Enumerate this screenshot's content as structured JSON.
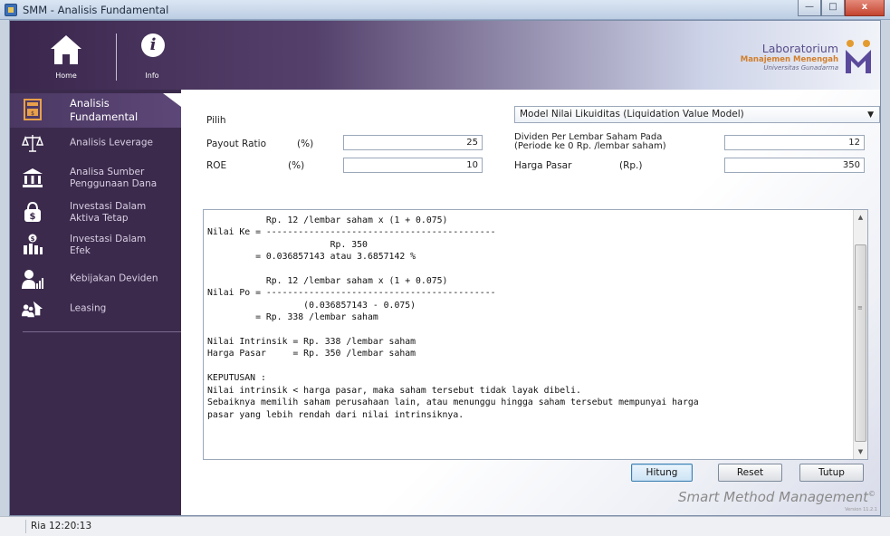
{
  "window": {
    "title": "SMM - Analisis Fundamental",
    "buttons": {
      "minimize": "—",
      "maximize": "□",
      "close": "x"
    }
  },
  "header": {
    "home_label": "Home",
    "info_label": "Info",
    "lab_line1": "Laboratorium",
    "lab_line2": "Manajemen Menengah",
    "lab_line3": "Universitas Gunadarma"
  },
  "sidebar": {
    "items": [
      {
        "label_line1": "Analisis",
        "label_line2": "Fundamental",
        "active": true,
        "icon": "calculator-icon"
      },
      {
        "label_line1": "Analisis Leverage",
        "label_line2": "",
        "icon": "balance-scale-icon"
      },
      {
        "label_line1": "Analisa Sumber",
        "label_line2": "Penggunaan Dana",
        "icon": "bank-icon"
      },
      {
        "label_line1": "Investasi Dalam",
        "label_line2": "Aktiva Tetap",
        "icon": "money-bag-icon"
      },
      {
        "label_line1": "Investasi Dalam",
        "label_line2": "Efek",
        "icon": "investment-chart-icon"
      },
      {
        "label_line1": "Kebijakan Deviden",
        "label_line2": "",
        "icon": "user-chart-icon"
      },
      {
        "label_line1": "Leasing",
        "label_line2": "",
        "icon": "people-house-icon"
      }
    ]
  },
  "form": {
    "pilih_label": "Pilih",
    "model_selected": "Model Nilai Likuiditas (Liquidation Value Model)",
    "payout_label": "Payout Ratio",
    "payout_unit": "(%)",
    "payout_value": "25",
    "roe_label": "ROE",
    "roe_unit": "(%)",
    "roe_value": "10",
    "dividen_label_line1": "Dividen Per Lembar Saham Pada",
    "dividen_label_line2": "(Periode ke 0 Rp. /lembar saham)",
    "dividen_value": "12",
    "harga_label": "Harga Pasar",
    "harga_unit": "(Rp.)",
    "harga_value": "350"
  },
  "output": {
    "text": "           Rp. 12 /lembar saham x (1 + 0.075)\nNilai Ke = -------------------------------------------\n                       Rp. 350\n         = 0.036857143 atau 3.6857142 %\n\n           Rp. 12 /lembar saham x (1 + 0.075)\nNilai Po = -------------------------------------------\n                  (0.036857143 - 0.075)\n         = Rp. 338 /lembar saham\n\nNilai Intrinsik = Rp. 338 /lembar saham\nHarga Pasar     = Rp. 350 /lembar saham\n\nKEPUTUSAN :\nNilai intrinsik < harga pasar, maka saham tersebut tidak layak dibeli.\nSebaiknya memilih saham perusahaan lain, atau menunggu hingga saham tersebut mempunyai harga\npasar yang lebih rendah dari nilai intrinsiknya."
  },
  "actions": {
    "hitung": "Hitung",
    "reset": "Reset",
    "tutup": "Tutup"
  },
  "brand": {
    "smm": "Smart Method Management",
    "version": "Version 11.2.1"
  },
  "status": {
    "text": "Ria  12:20:13"
  }
}
